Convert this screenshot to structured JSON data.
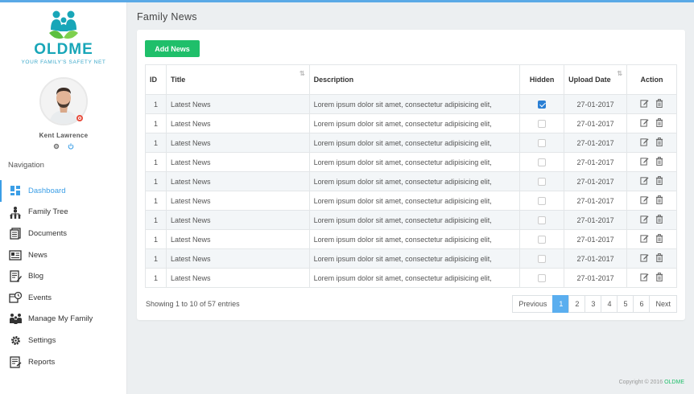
{
  "brand": {
    "name": "OLDME",
    "tagline": "YOUR FAMILY'S SAFETY NET",
    "color": "#18a6b8"
  },
  "user": {
    "name": "Kent Lawrence"
  },
  "sidebar": {
    "heading": "Navigation",
    "items": [
      {
        "label": "Dashboard",
        "icon": "dashboard-icon"
      },
      {
        "label": "Family Tree",
        "icon": "family-tree-icon"
      },
      {
        "label": "Documents",
        "icon": "documents-icon"
      },
      {
        "label": "News",
        "icon": "news-icon"
      },
      {
        "label": "Blog",
        "icon": "blog-icon"
      },
      {
        "label": "Events",
        "icon": "events-icon"
      },
      {
        "label": "Manage My Family",
        "icon": "family-icon"
      },
      {
        "label": "Settings",
        "icon": "settings-icon"
      },
      {
        "label": "Reports",
        "icon": "reports-icon"
      }
    ]
  },
  "page": {
    "title": "Family News",
    "add_button": "Add News"
  },
  "table": {
    "headers": [
      "ID",
      "Title",
      "Description",
      "Hidden",
      "Upload Date",
      "Action"
    ],
    "rows": [
      {
        "id": "1",
        "title": "Latest News",
        "description": "Lorem ipsum dolor sit amet, consectetur adipisicing elit,",
        "hidden": true,
        "date": "27-01-2017"
      },
      {
        "id": "1",
        "title": "Latest News",
        "description": "Lorem ipsum dolor sit amet, consectetur adipisicing elit,",
        "hidden": false,
        "date": "27-01-2017"
      },
      {
        "id": "1",
        "title": "Latest News",
        "description": "Lorem ipsum dolor sit amet, consectetur adipisicing elit,",
        "hidden": false,
        "date": "27-01-2017"
      },
      {
        "id": "1",
        "title": "Latest News",
        "description": "Lorem ipsum dolor sit amet, consectetur adipisicing elit,",
        "hidden": false,
        "date": "27-01-2017"
      },
      {
        "id": "1",
        "title": "Latest News",
        "description": "Lorem ipsum dolor sit amet, consectetur adipisicing elit,",
        "hidden": false,
        "date": "27-01-2017"
      },
      {
        "id": "1",
        "title": "Latest News",
        "description": "Lorem ipsum dolor sit amet, consectetur adipisicing elit,",
        "hidden": false,
        "date": "27-01-2017"
      },
      {
        "id": "1",
        "title": "Latest News",
        "description": "Lorem ipsum dolor sit amet, consectetur adipisicing elit,",
        "hidden": false,
        "date": "27-01-2017"
      },
      {
        "id": "1",
        "title": "Latest News",
        "description": "Lorem ipsum dolor sit amet, consectetur adipisicing elit,",
        "hidden": false,
        "date": "27-01-2017"
      },
      {
        "id": "1",
        "title": "Latest News",
        "description": "Lorem ipsum dolor sit amet, consectetur adipisicing elit,",
        "hidden": false,
        "date": "27-01-2017"
      },
      {
        "id": "1",
        "title": "Latest News",
        "description": "Lorem ipsum dolor sit amet, consectetur adipisicing elit,",
        "hidden": false,
        "date": "27-01-2017"
      }
    ]
  },
  "pagination": {
    "info": "Showing 1 to 10 of 57 entries",
    "previous": "Previous",
    "pages": [
      "1",
      "2",
      "3",
      "4",
      "5",
      "6"
    ],
    "current": "1",
    "next": "Next"
  },
  "footer": {
    "text": "Copyright © 2016",
    "brand": "OLDME"
  },
  "colors": {
    "accent": "#3b9ee6",
    "success": "#1fbf6a",
    "checkbox": "#2a7fd4"
  }
}
